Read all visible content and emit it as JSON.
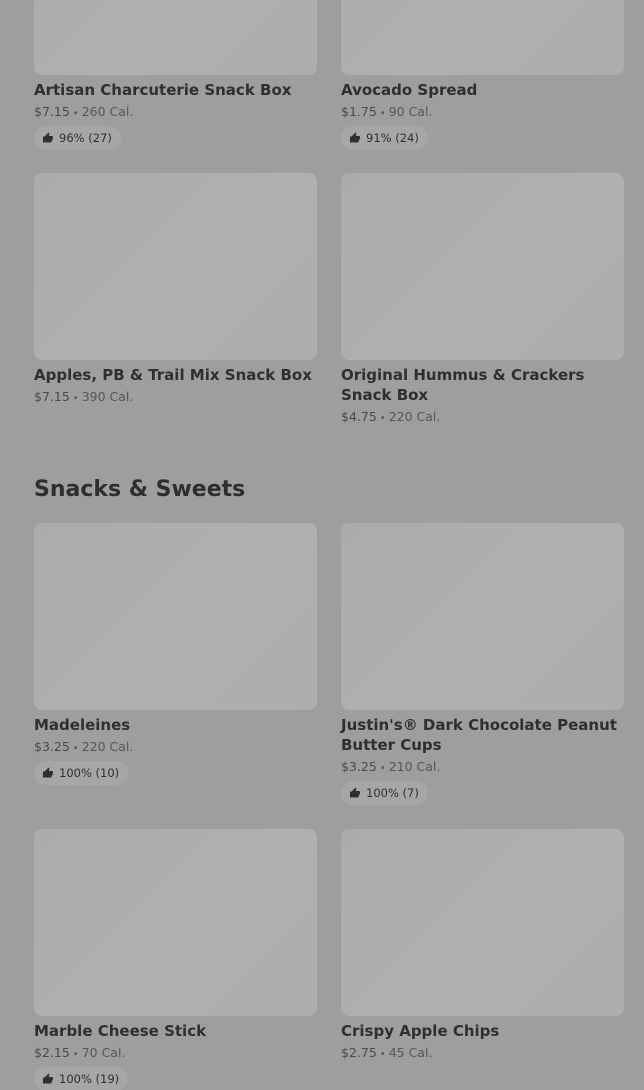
{
  "items_top": [
    {
      "name": "Artisan Charcuterie Snack Box",
      "price": "$7.15",
      "calories": "260 Cal.",
      "rating": "96% (27)"
    },
    {
      "name": "Avocado Spread",
      "price": "$1.75",
      "calories": "90 Cal.",
      "rating": "91% (24)"
    },
    {
      "name": "Apples, PB & Trail Mix Snack Box",
      "price": "$7.15",
      "calories": "390 Cal."
    },
    {
      "name": "Original Hummus & Crackers Snack Box",
      "price": "$4.75",
      "calories": "220 Cal."
    }
  ],
  "section": {
    "title": "Snacks & Sweets"
  },
  "items_snacks": [
    {
      "name": "Madeleines",
      "price": "$3.25",
      "calories": "220 Cal.",
      "rating": "100% (10)"
    },
    {
      "name": "Justin's® Dark Chocolate Peanut Butter Cups",
      "price": "$3.25",
      "calories": "210 Cal.",
      "rating": "100% (7)"
    },
    {
      "name": "Marble Cheese Stick",
      "price": "$2.15",
      "calories": "70 Cal.",
      "rating": "100% (19)"
    },
    {
      "name": "Crispy Apple Chips",
      "price": "$2.75",
      "calories": "45 Cal."
    }
  ],
  "separator": "•",
  "icons": {
    "rating": "thumbs-up-icon"
  }
}
